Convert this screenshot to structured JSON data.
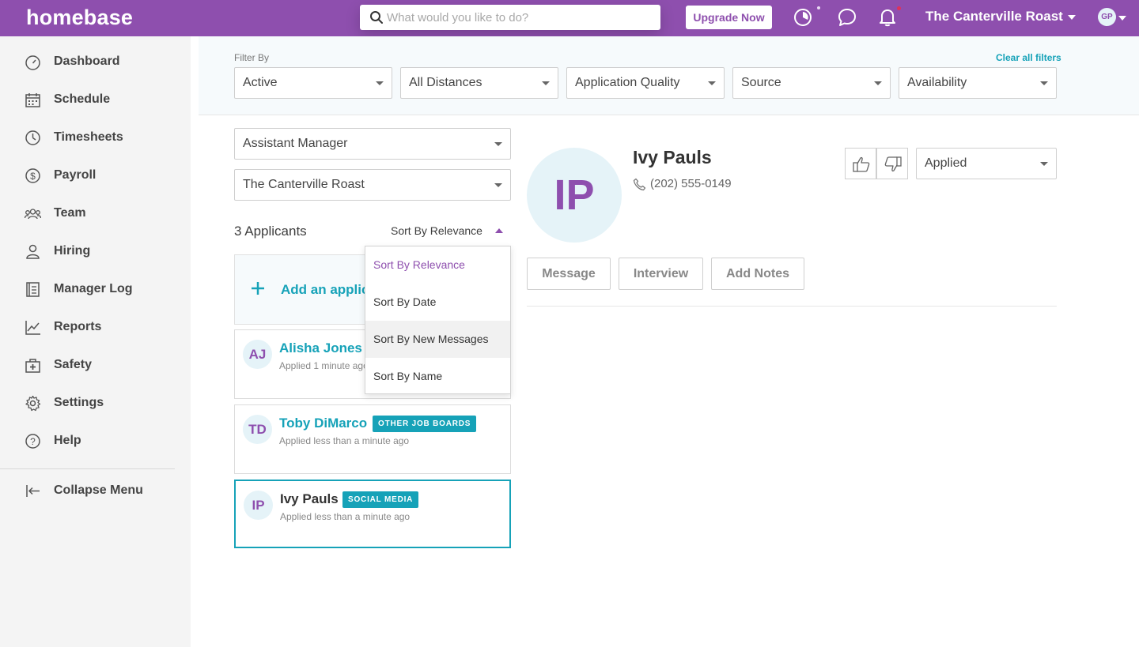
{
  "header": {
    "logo": "homebase",
    "search_placeholder": "What would you like to do?",
    "upgrade_label": "Upgrade Now",
    "location": "The Canterville Roast",
    "user_initials": "GP",
    "icons": [
      "clock-icon",
      "chat-icon",
      "bell-icon",
      "search-icon"
    ],
    "colors": {
      "brand": "#8e4fae",
      "accent": "#16a2b8",
      "notification_dot": "#e0315a"
    }
  },
  "sidebar": {
    "items": [
      {
        "label": "Dashboard",
        "icon": "dashboard-icon"
      },
      {
        "label": "Schedule",
        "icon": "calendar-icon"
      },
      {
        "label": "Timesheets",
        "icon": "clock-icon"
      },
      {
        "label": "Payroll",
        "icon": "dollar-icon"
      },
      {
        "label": "Team",
        "icon": "team-icon"
      },
      {
        "label": "Hiring",
        "icon": "person-icon"
      },
      {
        "label": "Manager Log",
        "icon": "log-icon"
      },
      {
        "label": "Reports",
        "icon": "chart-icon"
      },
      {
        "label": "Safety",
        "icon": "first-aid-icon"
      },
      {
        "label": "Settings",
        "icon": "gear-icon"
      },
      {
        "label": "Help",
        "icon": "help-icon"
      }
    ],
    "collapse_label": "Collapse Menu"
  },
  "filters": {
    "label": "Filter By",
    "clear_label": "Clear all filters",
    "selects": [
      "Active",
      "All Distances",
      "Application Quality",
      "Source",
      "Availability"
    ]
  },
  "list": {
    "role_select": "Assistant Manager",
    "location_select": "The Canterville Roast",
    "count_label": "3 Applicants",
    "sort_label": "Sort By Relevance",
    "add_label": "Add an applic",
    "sort_options": [
      "Sort By Relevance",
      "Sort By Date",
      "Sort By New Messages",
      "Sort By Name"
    ],
    "applicants": [
      {
        "initials": "AJ",
        "name": "Alisha Jones",
        "meta": "Applied 1 minute ago",
        "badge": ""
      },
      {
        "initials": "TD",
        "name": "Toby DiMarco",
        "meta": "Applied less than a minute ago",
        "badge": "OTHER JOB BOARDS"
      },
      {
        "initials": "IP",
        "name": "Ivy Pauls",
        "meta": "Applied less than a minute ago",
        "badge": "SOCIAL MEDIA"
      }
    ]
  },
  "detail": {
    "initials": "IP",
    "name": "Ivy Pauls",
    "phone": "(202) 555-0149",
    "status": "Applied",
    "actions": [
      "Message",
      "Interview",
      "Add Notes"
    ]
  }
}
